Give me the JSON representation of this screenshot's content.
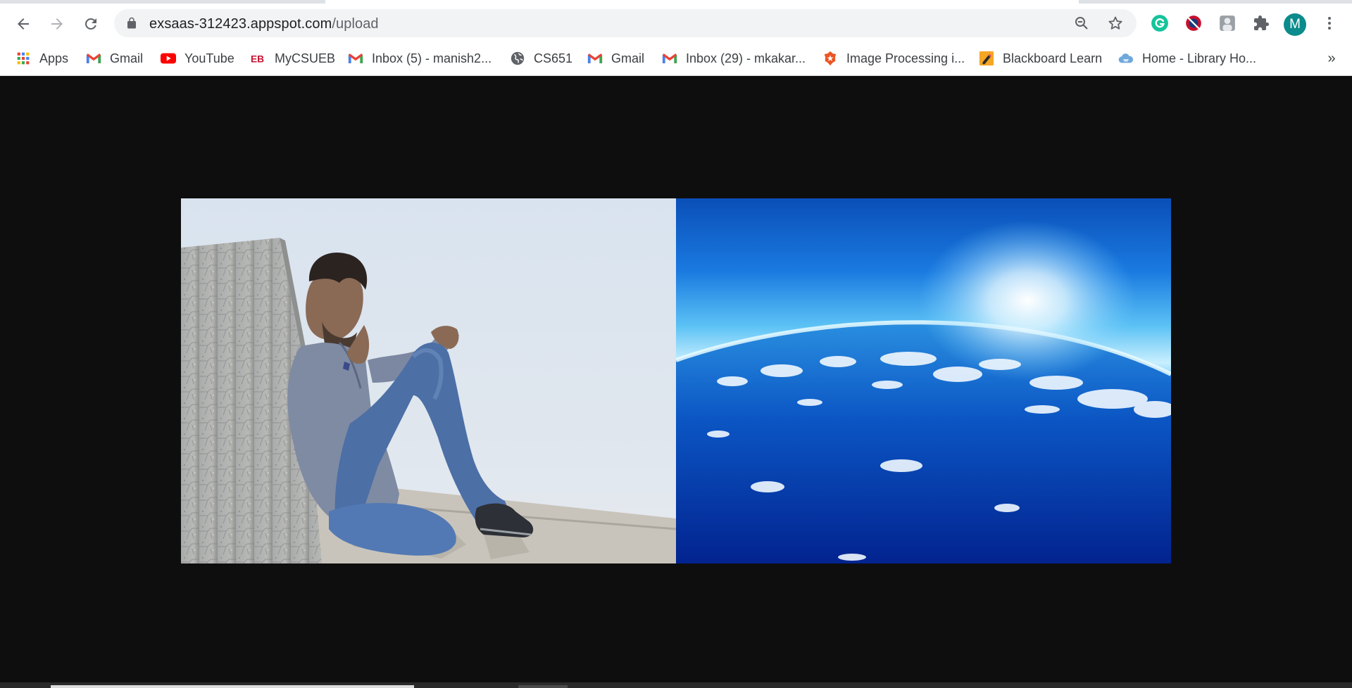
{
  "browser": {
    "url_host": "exsaas-312423.appspot.com",
    "url_path": "/upload",
    "profile_initial": "M",
    "nav": {
      "back_icon": "arrow-left-icon",
      "forward_icon": "arrow-right-icon",
      "reload_icon": "reload-icon"
    },
    "omnibox_icons": [
      "zoom-out-icon",
      "star-icon"
    ],
    "extensions": [
      "grammarly-icon",
      "blocker-extension-icon",
      "profile-photo-extension-icon",
      "puzzle-extensions-icon"
    ],
    "menu_icon": "kebab-menu-icon"
  },
  "bookmarks": [
    {
      "label": "Apps",
      "icon": "apps-grid-icon"
    },
    {
      "label": "Gmail",
      "icon": "gmail-icon"
    },
    {
      "label": "YouTube",
      "icon": "youtube-icon"
    },
    {
      "label": "MyCSUEB",
      "icon": "eb-icon"
    },
    {
      "label": "Inbox (5) - manish2...",
      "icon": "gmail-icon"
    },
    {
      "label": "CS651",
      "icon": "globe-icon"
    },
    {
      "label": "Gmail",
      "icon": "gmail-icon"
    },
    {
      "label": "Inbox (29) - mkakar...",
      "icon": "gmail-icon"
    },
    {
      "label": "Image Processing i...",
      "icon": "auth0-icon"
    },
    {
      "label": "Blackboard Learn",
      "icon": "blackboard-icon"
    },
    {
      "label": "Home - Library Ho...",
      "icon": "cloud-icon"
    }
  ],
  "bookmarks_overflow": "»",
  "page": {
    "images": [
      {
        "subject": "man-sitting-against-wall-photo"
      },
      {
        "subject": "earth-atmosphere-from-space-photo"
      }
    ]
  },
  "colors": {
    "page_background": "#0e0e0e",
    "profile_avatar": "#0b8b8b",
    "grammarly": "#15c39a",
    "youtube": "#ff0000"
  }
}
